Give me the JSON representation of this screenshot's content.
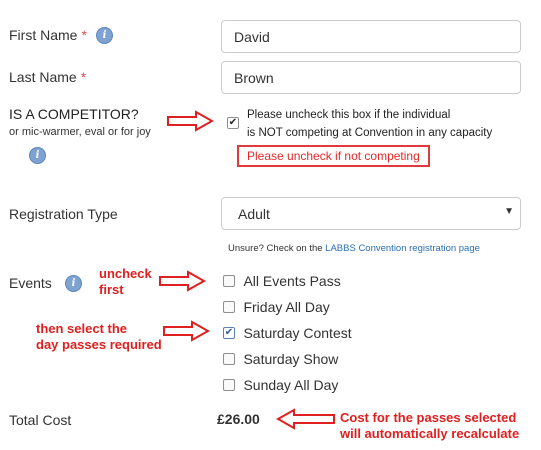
{
  "form": {
    "first_name": {
      "label": "First Name",
      "required_mark": "*",
      "value": "David"
    },
    "last_name": {
      "label": "Last Name",
      "required_mark": "*",
      "value": "Brown"
    },
    "competitor": {
      "heading": "IS A COMPETITOR?",
      "sublabel": "or mic-warmer, eval or for joy",
      "checkbox_text_line1": "Please uncheck this box if the individual",
      "checkbox_text_line2": "is NOT competing at Convention in any capacity",
      "checked": true
    },
    "registration_type": {
      "label": "Registration Type",
      "selected": "Adult",
      "hint_prefix": "Unsure? Check on the",
      "hint_link": "LABBS Convention registration page"
    },
    "events": {
      "label": "Events",
      "options": [
        {
          "label": "All Events Pass",
          "checked": false
        },
        {
          "label": "Friday All Day",
          "checked": false
        },
        {
          "label": "Saturday Contest",
          "checked": true
        },
        {
          "label": "Saturday Show",
          "checked": false
        },
        {
          "label": "Sunday All Day",
          "checked": false
        }
      ]
    },
    "total": {
      "label": "Total Cost",
      "value": "£26.00"
    }
  },
  "annotations": {
    "uncheck_competing": "Please uncheck if not competing",
    "uncheck_first_line1": "uncheck",
    "uncheck_first_line2": "first",
    "select_day_line1": "then select the",
    "select_day_line2": "day passes required",
    "cost_line1": "Cost for the passes selected",
    "cost_line2": "will automatically recalculate"
  },
  "icons": {
    "info": "info-icon",
    "checkmark": "check-icon",
    "arrow": "red-outline-arrow-icon",
    "chevron": "chevron-down-icon"
  },
  "colors": {
    "annotation_red": "#e02020",
    "info_blue": "#7fa3d1",
    "link_blue": "#2a6fb5"
  }
}
